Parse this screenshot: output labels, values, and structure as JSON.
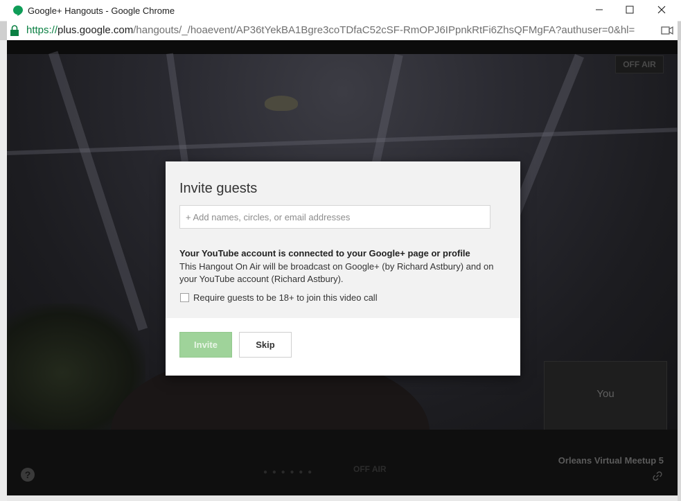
{
  "window": {
    "title": "Google+ Hangouts - Google Chrome"
  },
  "addressbar": {
    "scheme": "https://",
    "host": "plus.google.com",
    "path": "/hangouts/_/hoaevent/AP36tYekBA1Bgre3coTDfaC52cSF-RmOPJ6IPpnkRtFi6ZhsQFMgFA?authuser=0&hl="
  },
  "hangout": {
    "offair_tag": "OFF AIR",
    "self_view_label": "You",
    "bottom_offair": "OFF AIR",
    "event_name": "Orleans Virtual Meetup 5",
    "help_label": "?"
  },
  "modal": {
    "title": "Invite guests",
    "input_placeholder": "+ Add names, circles, or email addresses",
    "input_value": "",
    "youtube_heading": "Your YouTube account is connected to your Google+ page or profile",
    "youtube_body": "This Hangout On Air will be broadcast on Google+ (by Richard Astbury) and on your YouTube account (Richard Astbury).",
    "age_checkbox_label": "Require guests to be 18+ to join this video call",
    "age_checkbox_checked": false,
    "invite_button": "Invite",
    "skip_button": "Skip"
  },
  "colors": {
    "invite_button_bg": "#9fd39a",
    "url_scheme": "#0b8043",
    "modal_bg": "#f2f2f2"
  },
  "icons": [
    "hangouts-icon",
    "minimize-icon",
    "maximize-icon",
    "close-icon",
    "lock-icon",
    "camera-blocked-icon",
    "link-icon",
    "help-icon"
  ]
}
